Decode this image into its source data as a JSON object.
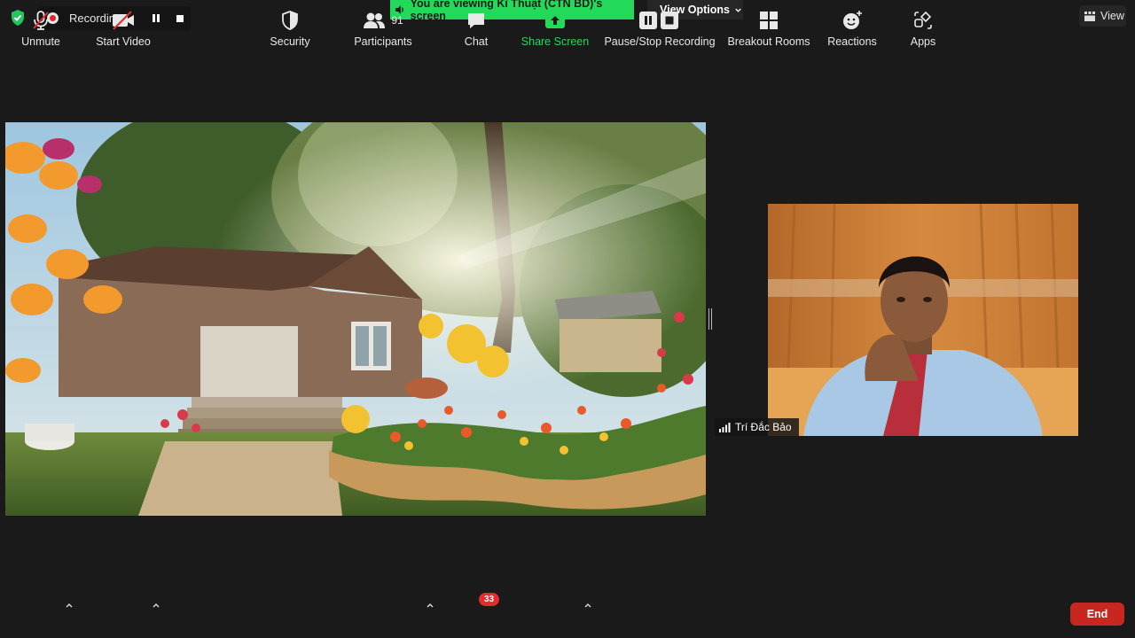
{
  "colors": {
    "background": "#1a1a1a",
    "banner_green": "#23d959",
    "end_red": "#c7271f",
    "badge_red": "#e02d2d"
  },
  "top_bar": {
    "recording_label": "Recording...",
    "viewing_banner": "You are viewing Kĩ Thuật (CTN BD)'s screen",
    "view_options_label": "View Options",
    "view_label": "View"
  },
  "participant": {
    "name": "Trí Đắc Bảo"
  },
  "toolbar": {
    "unmute_label": "Unmute",
    "start_video_label": "Start Video",
    "security_label": "Security",
    "participants_label": "Participants",
    "participants_count": "91",
    "chat_label": "Chat",
    "chat_badge": "33",
    "share_screen_label": "Share Screen",
    "pause_stop_recording_label": "Pause/Stop Recording",
    "breakout_rooms_label": "Breakout Rooms",
    "reactions_label": "Reactions",
    "apps_label": "Apps",
    "end_label": "End"
  },
  "icons": [
    "shield-check-icon",
    "recording-dot-icon",
    "pause-icon",
    "stop-icon",
    "speaker-icon",
    "chevron-down-icon",
    "grid-icon",
    "signal-icon",
    "mic-muted-icon",
    "video-off-icon",
    "security-shield-icon",
    "participants-icon",
    "chat-icon",
    "share-screen-icon",
    "pause-stop-recording-icon",
    "breakout-rooms-icon",
    "reactions-icon",
    "apps-icon"
  ]
}
